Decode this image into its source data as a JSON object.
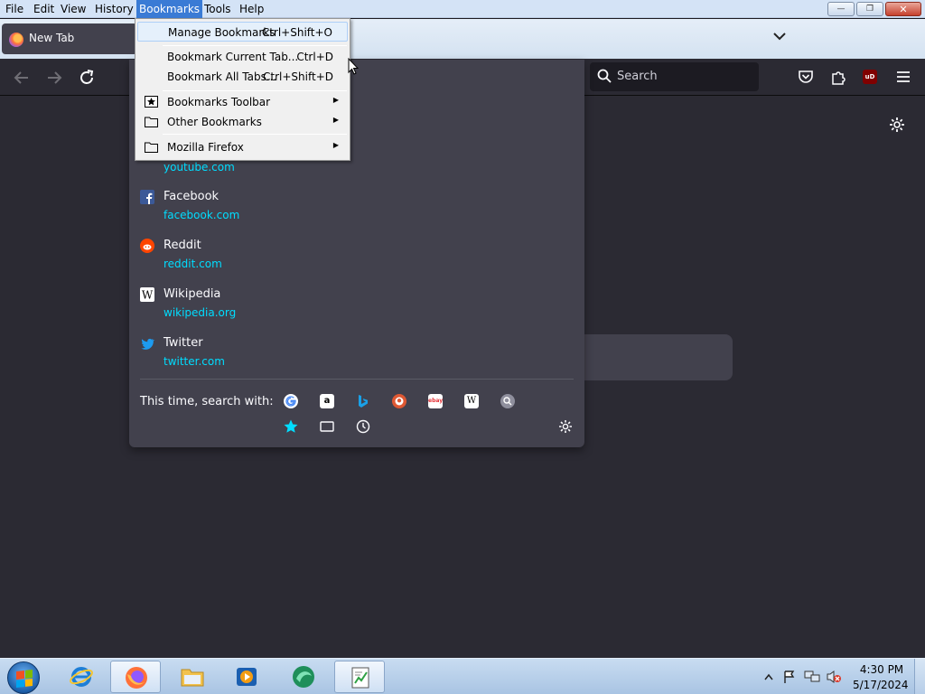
{
  "menubar": {
    "items": [
      "File",
      "Edit",
      "View",
      "History",
      "Bookmarks",
      "Tools",
      "Help"
    ]
  },
  "window_controls": {
    "minimize": "—",
    "restore": "❐",
    "close": "✕"
  },
  "tab": {
    "title": "New Tab"
  },
  "navbar": {
    "search_placeholder": "Search",
    "ublock_label": "uD"
  },
  "suggestions": [
    {
      "name": "",
      "url": "youtube.com",
      "icon": "youtube-icon"
    },
    {
      "name": "Facebook",
      "url": "facebook.com",
      "icon": "facebook-icon"
    },
    {
      "name": "Reddit",
      "url": "reddit.com",
      "icon": "reddit-icon"
    },
    {
      "name": "Wikipedia",
      "url": "wikipedia.org",
      "icon": "wikipedia-icon"
    },
    {
      "name": "Twitter",
      "url": "twitter.com",
      "icon": "twitter-icon"
    }
  ],
  "search_with": {
    "label": "This time, search with:",
    "engines": [
      "google",
      "amazon",
      "bing",
      "duckduckgo",
      "ebay",
      "wikipedia",
      "search"
    ],
    "ebay_label": "ebay",
    "wiki_label": "W",
    "amazon_label": "a"
  },
  "bookmarks_menu": {
    "manage": {
      "label": "Manage Bookmarks",
      "shortcut": "Ctrl+Shift+O"
    },
    "bookmark_current": {
      "label": "Bookmark Current Tab...",
      "shortcut": "Ctrl+D"
    },
    "bookmark_all": {
      "label": "Bookmark All Tabs...",
      "shortcut": "Ctrl+Shift+D"
    },
    "toolbar": {
      "label": "Bookmarks Toolbar"
    },
    "other": {
      "label": "Other Bookmarks"
    },
    "mozilla": {
      "label": "Mozilla Firefox"
    }
  },
  "taskbar": {
    "apps": [
      "internet-explorer",
      "firefox",
      "file-explorer",
      "media-player",
      "app-green",
      "notepad-app"
    ],
    "clock_time": "4:30 PM",
    "clock_date": "5/17/2024"
  },
  "colors": {
    "accent": "#00ddff",
    "panel": "#42414d",
    "toolbar": "#2b2a33",
    "page": "#1c1b22"
  }
}
